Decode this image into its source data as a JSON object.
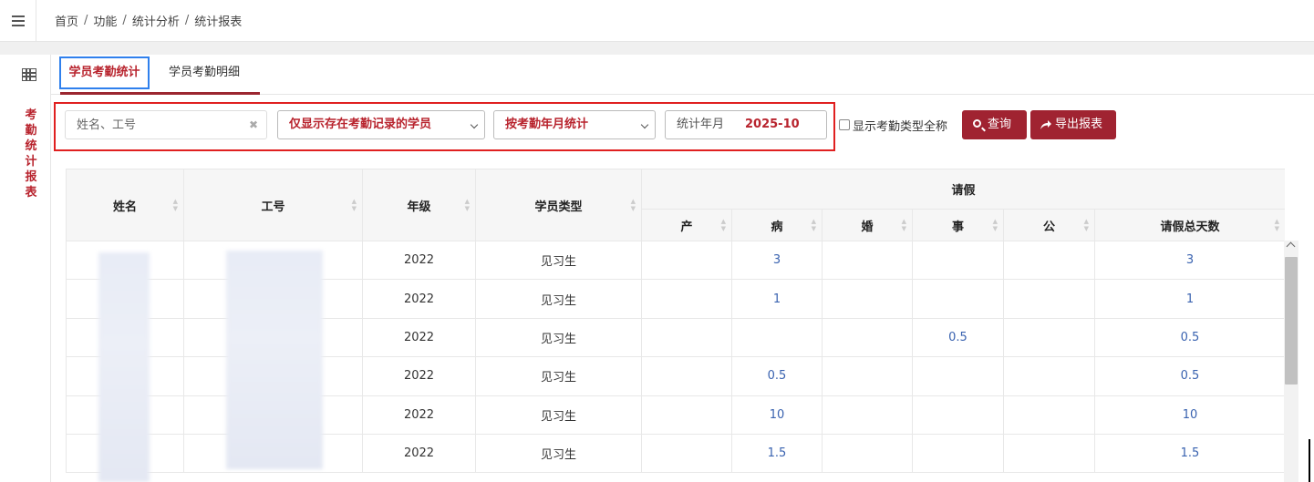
{
  "breadcrumb": [
    "首页",
    "功能",
    "统计分析",
    "统计报表"
  ],
  "sidebar": {
    "vertical_title": [
      "考",
      "勤",
      "统",
      "计",
      "报",
      "表"
    ]
  },
  "tabs": [
    {
      "label": "学员考勤统计",
      "active": true
    },
    {
      "label": "学员考勤明细",
      "active": false
    }
  ],
  "filters": {
    "name_placeholder": "姓名、工号",
    "clear_glyph": "✖",
    "student_filter": "仅显示存在考勤记录的学员",
    "stat_mode": "按考勤年月统计",
    "month_label": "统计年月",
    "month_value": "2025-10",
    "show_fullname_label": "显示考勤类型全称",
    "query_label": "查询",
    "export_label": "导出报表"
  },
  "table": {
    "headers": {
      "name": "姓名",
      "id": "工号",
      "grade": "年级",
      "type": "学员类型",
      "leave_group": "请假",
      "leave_cols": [
        "产",
        "病",
        "婚",
        "事",
        "公",
        "请假总天数"
      ]
    },
    "rows": [
      {
        "grade": "2022",
        "type": "见习生",
        "chan": "",
        "bing": "3",
        "hun": "",
        "shi": "",
        "gong": "",
        "total": "3"
      },
      {
        "grade": "2022",
        "type": "见习生",
        "chan": "",
        "bing": "1",
        "hun": "",
        "shi": "",
        "gong": "",
        "total": "1"
      },
      {
        "grade": "2022",
        "type": "见习生",
        "chan": "",
        "bing": "",
        "hun": "",
        "shi": "0.5",
        "gong": "",
        "total": "0.5"
      },
      {
        "grade": "2022",
        "type": "见习生",
        "chan": "",
        "bing": "0.5",
        "hun": "",
        "shi": "",
        "gong": "",
        "total": "0.5"
      },
      {
        "grade": "2022",
        "type": "见习生",
        "chan": "",
        "bing": "10",
        "hun": "",
        "shi": "",
        "gong": "",
        "total": "10"
      },
      {
        "grade": "2022",
        "type": "见习生",
        "chan": "",
        "bing": "1.5",
        "hun": "",
        "shi": "",
        "gong": "",
        "total": "1.5"
      }
    ]
  },
  "colors": {
    "accent": "#b8232d",
    "button_bg": "#a02331",
    "link_blue": "#3a63b0",
    "highlight_red": "#e02020",
    "highlight_blue": "#2f80ed"
  }
}
